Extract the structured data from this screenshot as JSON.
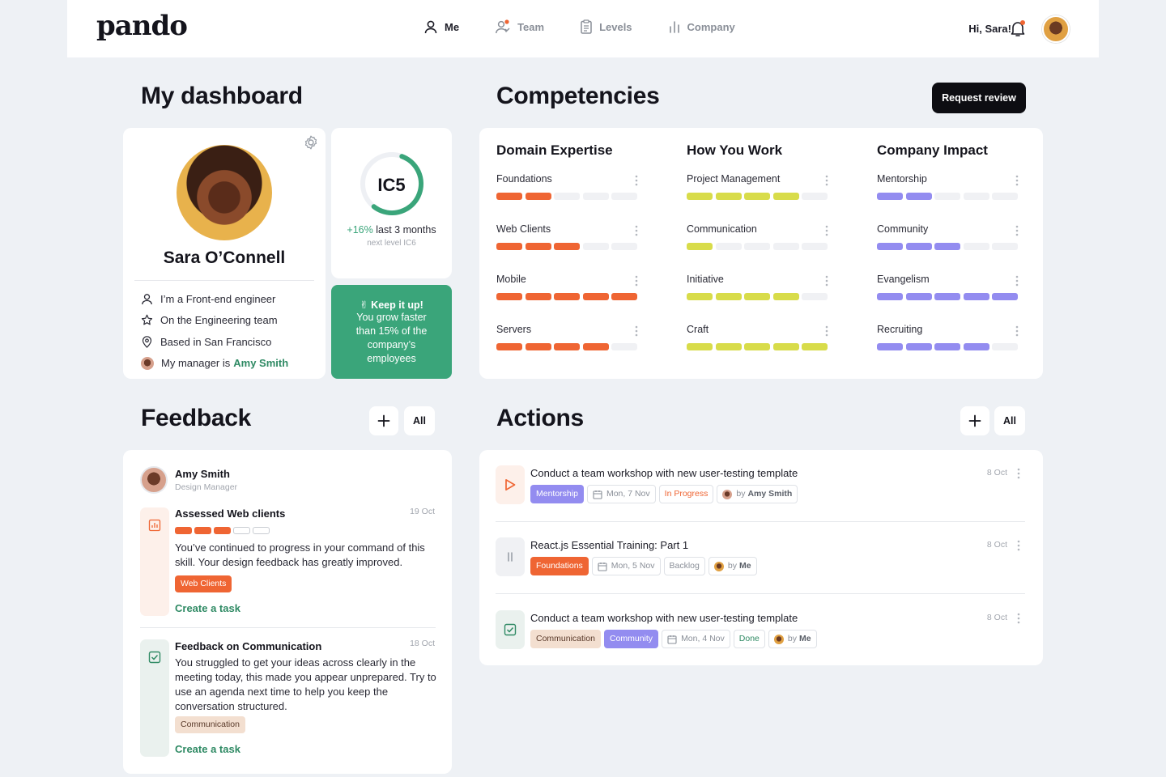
{
  "app": {
    "logo": "pando"
  },
  "nav": {
    "me": "Me",
    "team": "Team",
    "levels": "Levels",
    "company": "Company"
  },
  "header": {
    "greeting": "Hi, Sara!"
  },
  "dashboard": {
    "title": "My dashboard"
  },
  "profile": {
    "name": "Sara O’Connell",
    "role": "I’m a Front-end engineer",
    "team": "On the Engineering team",
    "location": "Based in San Francisco",
    "manager_prefix": "My manager is",
    "manager_name": "Amy Smith"
  },
  "level": {
    "current": "IC5",
    "progress_fraction": 0.55,
    "growth_pct": "+16%",
    "growth_suffix": " last 3 months",
    "next": "next level IC6"
  },
  "encourage": {
    "title": "✌ Keep it up!",
    "body": "You grow faster than 15% of the company’s employees"
  },
  "competencies": {
    "title": "Competencies",
    "request_review": "Request review",
    "columns": [
      {
        "title": "Domain Expertise",
        "color": "#ef6533",
        "skills": [
          {
            "name": "Foundations",
            "level": 2
          },
          {
            "name": "Web Clients",
            "level": 3
          },
          {
            "name": "Mobile",
            "level": 5
          },
          {
            "name": "Servers",
            "level": 4
          }
        ]
      },
      {
        "title": "How You Work",
        "color": "#d8dc4a",
        "skills": [
          {
            "name": "Project Management",
            "level": 4
          },
          {
            "name": "Communication",
            "level": 1
          },
          {
            "name": "Initiative",
            "level": 4
          },
          {
            "name": "Craft",
            "level": 5
          }
        ]
      },
      {
        "title": "Company Impact",
        "color": "#938cf0",
        "skills": [
          {
            "name": "Mentorship",
            "level": 2
          },
          {
            "name": "Community",
            "level": 3
          },
          {
            "name": "Evangelism",
            "level": 5
          },
          {
            "name": "Recruiting",
            "level": 4
          }
        ]
      }
    ]
  },
  "feedback": {
    "title": "Feedback",
    "all_label": "All",
    "author_name": "Amy Smith",
    "author_role": "Design Manager",
    "items": [
      {
        "title": "Assessed Web clients",
        "date": "19 Oct",
        "level": 3,
        "text": "You’ve continued to progress in your command of this skill. Your design feedback has greatly improved.",
        "tag": "Web Clients",
        "cta": "Create a task"
      },
      {
        "title": "Feedback on Communication",
        "date": "18 Oct",
        "text": "You struggled to get your ideas across clearly in the meeting today, this made you appear unprepared. Try to use an agenda next time to help you keep the conversation structured.",
        "tag": "Communication",
        "cta": "Create a task"
      }
    ]
  },
  "actions": {
    "title": "Actions",
    "all_label": "All",
    "items": [
      {
        "title": "Conduct a team workshop with new user-testing template",
        "date": "8 Oct",
        "tag": "Mentorship",
        "due": "Mon, 7 Nov",
        "status": "In Progress",
        "by_prefix": "by",
        "by": "Amy Smith"
      },
      {
        "title": "React.js Essential Training: Part 1",
        "date": "8 Oct",
        "tag": "Foundations",
        "due": "Mon, 5 Nov",
        "status": "Backlog",
        "by_prefix": "by",
        "by": "Me"
      },
      {
        "title": "Conduct a team workshop with new user-testing template",
        "date": "8 Oct",
        "tag": "Communication",
        "tag2": "Community",
        "due": "Mon, 4 Nov",
        "status": "Done",
        "by_prefix": "by",
        "by": "Me"
      }
    ]
  },
  "colors": {
    "accent_green": "#3aa57a",
    "orange": "#ef6533",
    "yellow": "#d8dc4a",
    "purple": "#938cf0"
  }
}
